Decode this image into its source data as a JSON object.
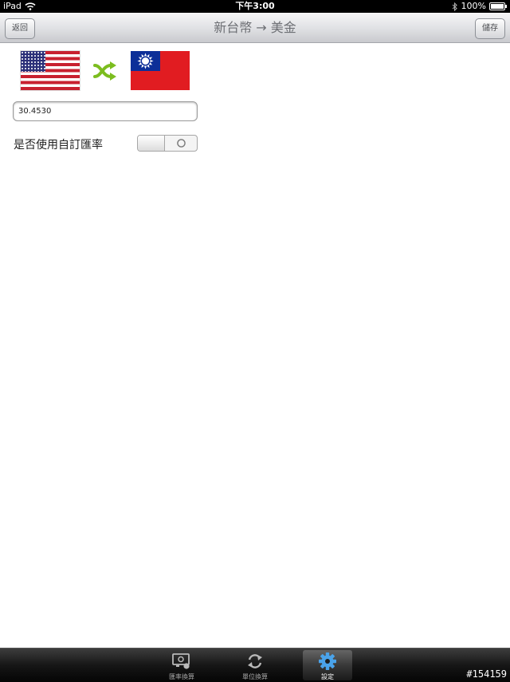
{
  "statusbar": {
    "device": "iPad",
    "time": "下午3:00",
    "battery": "100%"
  },
  "navbar": {
    "title": "新台幣 → 美金",
    "back_label": "返回",
    "save_label": "儲存"
  },
  "converter": {
    "from_flag": "us-flag",
    "to_flag": "taiwan-flag",
    "swap_icon": "swap-icon",
    "rate_value": "30.4530",
    "custom_rate_label": "是否使用自訂匯率",
    "custom_rate_enabled": false,
    "swap_color": "#7cbd1f"
  },
  "tabbar": {
    "tabs": [
      {
        "label": "匯率換算",
        "icon": "exchange-icon",
        "active": false
      },
      {
        "label": "單位換算",
        "icon": "refresh-icon",
        "active": false
      },
      {
        "label": "設定",
        "icon": "gear-icon",
        "active": true
      }
    ],
    "active_color": "#4aa3ea"
  },
  "watermark": "#154159"
}
